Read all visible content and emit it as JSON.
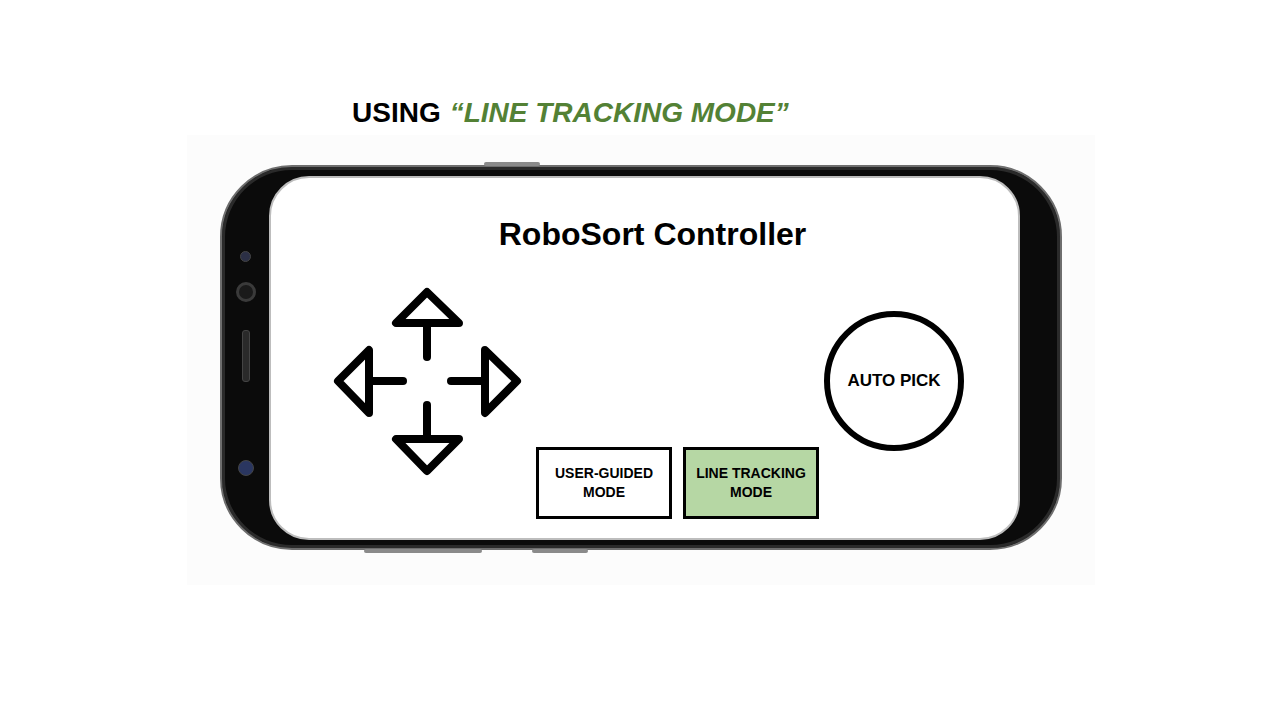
{
  "heading": {
    "prefix": "USING",
    "highlight": "“LINE TRACKING MODE”"
  },
  "app": {
    "title": "RoboSort Controller"
  },
  "modes": [
    {
      "label": "USER-GUIDED MODE",
      "selected": false
    },
    {
      "label": "LINE TRACKING MODE",
      "selected": true
    }
  ],
  "action_button": {
    "label": "AUTO PICK"
  }
}
